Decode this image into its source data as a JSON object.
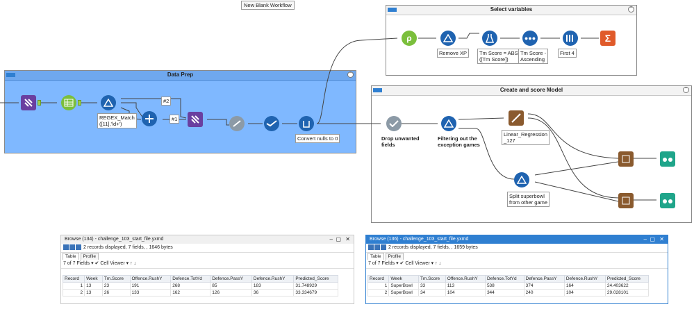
{
  "caption": "New Blank Workflow",
  "containers": {
    "data_prep": "Data Prep",
    "select_variables": "Select variables",
    "create_model": "Create and score Model"
  },
  "tools": {
    "regex_label_1": "REGEX_Match",
    "regex_label_2": "([11],'\\d+')",
    "select_2_label": "#2",
    "union_1_label": "#1",
    "convert_nulls": "Convert nulls to 0",
    "remove_xp": "Remove XP",
    "tm_abs_1": "Tm Score = ABS",
    "tm_abs_2": "([Tm Score])",
    "tm_sort_1": "Tm Score -",
    "tm_sort_2": "Ascending",
    "first4": "First 4",
    "drop_fields_1": "Drop unwanted",
    "drop_fields_2": "fields",
    "filter_exc_1": "Filtering out the",
    "filter_exc_2": "exception games",
    "linreg_1": "Linear_Regression",
    "linreg_2": "_127",
    "split_sb_1": "Split superbowl",
    "split_sb_2": "from other game"
  },
  "browse1": {
    "title": "Browse (134) - challenge_103_start_file.yxmd",
    "summary": "2 records displayed, 7 fields, , 1646 bytes",
    "tab_table": "Table",
    "tab_profile": "Profile",
    "fields": "7 of 7 Fields",
    "viewer": "Cell Viewer",
    "columns": [
      "Record",
      "Week",
      "Tm.Score",
      "Offence.RushY",
      "Defence.TotYd",
      "Defence.PassY",
      "Defence.RushY",
      "Predicted_Score"
    ],
    "rows": [
      [
        "1",
        "13",
        "23",
        "191",
        "268",
        "85",
        "183",
        "31.748929"
      ],
      [
        "2",
        "13",
        "26",
        "133",
        "162",
        "126",
        "36",
        "33.334679"
      ]
    ]
  },
  "browse2": {
    "title": "Browse (136) - challenge_103_start_file.yxmd",
    "summary": "2 records displayed, 7 fields, , 1659 bytes",
    "tab_table": "Table",
    "tab_profile": "Profile",
    "fields": "7 of 7 Fields",
    "viewer": "Cell Viewer",
    "columns": [
      "Record",
      "Week",
      "Tm.Score",
      "Offence.RushY",
      "Defence.TotYd",
      "Defence.PassY",
      "Defence.RushY",
      "Predicted_Score"
    ],
    "rows": [
      [
        "1",
        "SuperBowl",
        "33",
        "113",
        "538",
        "374",
        "164",
        "24.403622"
      ],
      [
        "2",
        "SuperBowl",
        "34",
        "104",
        "344",
        "240",
        "104",
        "29.028101"
      ]
    ]
  },
  "colors": {
    "container_blue": "#7fb8ff",
    "tool_blue": "#1f63b0",
    "tool_purple": "#6a3fa0",
    "tool_green": "#7bbf3c",
    "tool_orange": "#e05a2a",
    "tool_teal": "#1fa58a",
    "tool_grey": "#8c9aa6"
  }
}
